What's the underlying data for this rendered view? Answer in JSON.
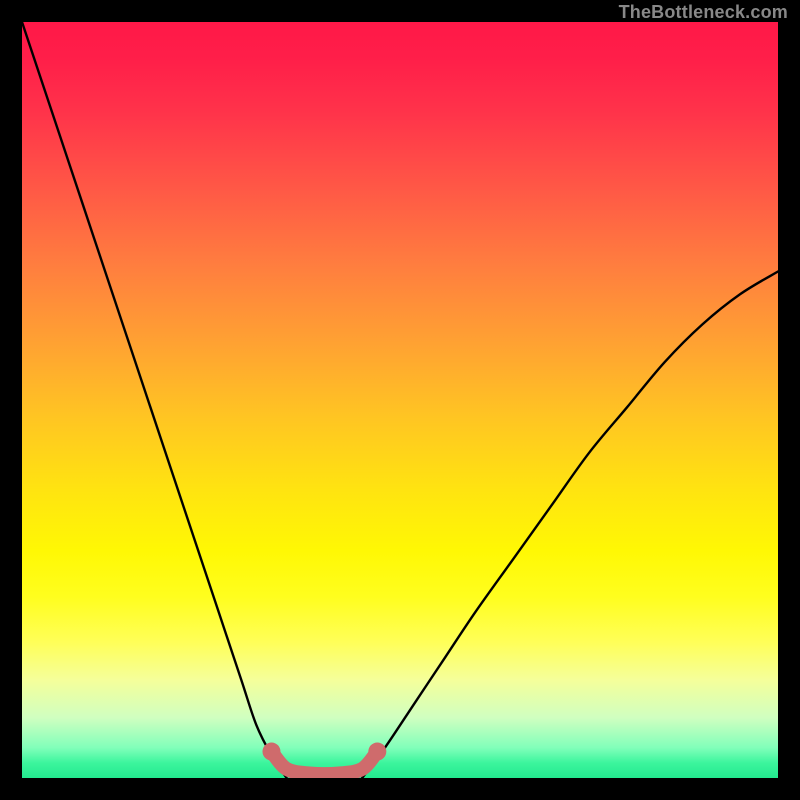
{
  "watermark": "TheBottleneck.com",
  "chart_data": {
    "type": "line",
    "title": "",
    "xlabel": "",
    "ylabel": "",
    "xlim": [
      0,
      100
    ],
    "ylim": [
      0,
      100
    ],
    "grid": false,
    "series": [
      {
        "name": "curve-left",
        "x": [
          0,
          2,
          5,
          8,
          11,
          14,
          17,
          20,
          23,
          26,
          29,
          31,
          33,
          35
        ],
        "y": [
          100,
          94,
          85,
          76,
          67,
          58,
          49,
          40,
          31,
          22,
          13,
          7,
          3,
          0
        ]
      },
      {
        "name": "curve-right",
        "x": [
          45,
          48,
          52,
          56,
          60,
          65,
          70,
          75,
          80,
          85,
          90,
          95,
          100
        ],
        "y": [
          0,
          4,
          10,
          16,
          22,
          29,
          36,
          43,
          49,
          55,
          60,
          64,
          67
        ]
      },
      {
        "name": "highlight-band",
        "x": [
          33,
          35,
          38,
          42,
          45,
          47
        ],
        "y": [
          3.5,
          1.2,
          0.6,
          0.6,
          1.2,
          3.5
        ]
      }
    ],
    "colors": {
      "curve": "#000000",
      "highlight": "#cf6b6c",
      "background_top": "#ff1848",
      "background_bottom": "#23e98f"
    }
  }
}
